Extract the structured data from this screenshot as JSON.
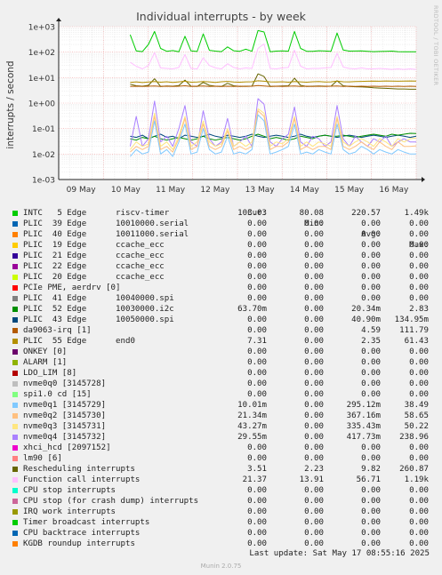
{
  "page": {
    "title": "Individual interrupts - by week",
    "watermark": "RRDTOOL / TOBI OETIKER",
    "last_update": "Last update: Sat May 17 08:55:16 2025",
    "footer": "Munin 2.0.75"
  },
  "legend_headers": {
    "cur": "Cur:",
    "min": "Min:",
    "avg": "Avg:",
    "max": "Max:"
  },
  "legend": [
    {
      "label": "INTC   5 Edge      riscv-timer",
      "color": "#00cc00",
      "cur": "103.03",
      "min": "80.08",
      "avg": "220.57",
      "max": "1.49k"
    },
    {
      "label": "PLIC  39 Edge      10010000.serial",
      "color": "#0066b3",
      "cur": "0.00",
      "min": "0.00",
      "avg": "0.00",
      "max": "0.00"
    },
    {
      "label": "PLIC  40 Edge      10011000.serial",
      "color": "#ff8000",
      "cur": "0.00",
      "min": "0.00",
      "avg": "0.00",
      "max": "0.00"
    },
    {
      "label": "PLIC  19 Edge      ccache_ecc",
      "color": "#ffcc00",
      "cur": "0.00",
      "min": "0.00",
      "avg": "0.00",
      "max": "0.00"
    },
    {
      "label": "PLIC  21 Edge      ccache_ecc",
      "color": "#330099",
      "cur": "0.00",
      "min": "0.00",
      "avg": "0.00",
      "max": "0.00"
    },
    {
      "label": "PLIC  22 Edge      ccache_ecc",
      "color": "#990099",
      "cur": "0.00",
      "min": "0.00",
      "avg": "0.00",
      "max": "0.00"
    },
    {
      "label": "PLIC  20 Edge      ccache_ecc",
      "color": "#ccff00",
      "cur": "0.00",
      "min": "0.00",
      "avg": "0.00",
      "max": "0.00"
    },
    {
      "label": "PCIe PME, aerdrv [0]",
      "color": "#ff0000",
      "cur": "0.00",
      "min": "0.00",
      "avg": "0.00",
      "max": "0.00"
    },
    {
      "label": "PLIC  41 Edge      10040000.spi",
      "color": "#808080",
      "cur": "0.00",
      "min": "0.00",
      "avg": "0.00",
      "max": "0.00"
    },
    {
      "label": "PLIC  52 Edge      10030000.i2c",
      "color": "#008f00",
      "cur": "63.70m",
      "min": "0.00",
      "avg": "20.34m",
      "max": "2.83"
    },
    {
      "label": "PLIC  43 Edge      10050000.spi",
      "color": "#00487d",
      "cur": "0.00",
      "min": "0.00",
      "avg": "40.90m",
      "max": "134.95m"
    },
    {
      "label": "da9063-irq [1]",
      "color": "#b35a00",
      "cur": "0.00",
      "min": "0.00",
      "avg": "4.59",
      "max": "111.79"
    },
    {
      "label": "PLIC  55 Edge      end0",
      "color": "#b38f00",
      "cur": "7.31",
      "min": "0.00",
      "avg": "2.35",
      "max": "61.43"
    },
    {
      "label": "ONKEY [0]",
      "color": "#6b006b",
      "cur": "0.00",
      "min": "0.00",
      "avg": "0.00",
      "max": "0.00"
    },
    {
      "label": "ALARM [1]",
      "color": "#8fb300",
      "cur": "0.00",
      "min": "0.00",
      "avg": "0.00",
      "max": "0.00"
    },
    {
      "label": "LDO_LIM [8]",
      "color": "#b30000",
      "cur": "0.00",
      "min": "0.00",
      "avg": "0.00",
      "max": "0.00"
    },
    {
      "label": "nvme0q0 [3145728]",
      "color": "#bebebe",
      "cur": "0.00",
      "min": "0.00",
      "avg": "0.00",
      "max": "0.00"
    },
    {
      "label": "spi1.0 cd [15]",
      "color": "#80ff80",
      "cur": "0.00",
      "min": "0.00",
      "avg": "0.00",
      "max": "0.00"
    },
    {
      "label": "nvme0q1 [3145729]",
      "color": "#80c9ff",
      "cur": "10.01m",
      "min": "0.00",
      "avg": "295.12m",
      "max": "38.49"
    },
    {
      "label": "nvme0q2 [3145730]",
      "color": "#ffc080",
      "cur": "21.34m",
      "min": "0.00",
      "avg": "367.16m",
      "max": "58.65"
    },
    {
      "label": "nvme0q3 [3145731]",
      "color": "#ffe680",
      "cur": "43.27m",
      "min": "0.00",
      "avg": "335.43m",
      "max": "50.22"
    },
    {
      "label": "nvme0q4 [3145732]",
      "color": "#aa80ff",
      "cur": "29.55m",
      "min": "0.00",
      "avg": "417.73m",
      "max": "238.96"
    },
    {
      "label": "xhci_hcd [2097152]",
      "color": "#ee00cc",
      "cur": "0.00",
      "min": "0.00",
      "avg": "0.00",
      "max": "0.00"
    },
    {
      "label": "lm90 [6]",
      "color": "#ff8080",
      "cur": "0.00",
      "min": "0.00",
      "avg": "0.00",
      "max": "0.00"
    },
    {
      "label": "Rescheduling interrupts",
      "color": "#666600",
      "cur": "3.51",
      "min": "2.23",
      "avg": "9.82",
      "max": "260.87"
    },
    {
      "label": "Function call interrupts",
      "color": "#ffbfff",
      "cur": "21.37",
      "min": "13.91",
      "avg": "56.71",
      "max": "1.19k"
    },
    {
      "label": "CPU stop interrupts",
      "color": "#00ffcc",
      "cur": "0.00",
      "min": "0.00",
      "avg": "0.00",
      "max": "0.00"
    },
    {
      "label": "CPU stop (for crash dump) interrupts",
      "color": "#cc6699",
      "cur": "0.00",
      "min": "0.00",
      "avg": "0.00",
      "max": "0.00"
    },
    {
      "label": "IRQ work interrupts",
      "color": "#999900",
      "cur": "0.00",
      "min": "0.00",
      "avg": "0.00",
      "max": "0.00"
    },
    {
      "label": "Timer broadcast interrupts",
      "color": "#00cc00",
      "cur": "0.00",
      "min": "0.00",
      "avg": "0.00",
      "max": "0.00"
    },
    {
      "label": "CPU backtrace interrupts",
      "color": "#0066b3",
      "cur": "0.00",
      "min": "0.00",
      "avg": "0.00",
      "max": "0.00"
    },
    {
      "label": "KGDB roundup interrupts",
      "color": "#ff8000",
      "cur": "0.00",
      "min": "0.00",
      "avg": "0.00",
      "max": "0.00"
    }
  ],
  "chart_data": {
    "type": "line",
    "title": "Individual interrupts - by week",
    "ylabel": "interrupts / second",
    "yscale": "log",
    "ylim": [
      0.001,
      1000
    ],
    "y_ticks": [
      "1e-03",
      "1e-02",
      "1e-01",
      "1e+00",
      "1e+01",
      "1e+02",
      "1e+03"
    ],
    "x_ticks": [
      "09 May",
      "10 May",
      "11 May",
      "12 May",
      "13 May",
      "14 May",
      "15 May",
      "16 May"
    ],
    "grid": true,
    "data_start_day": 1.6,
    "series": [
      {
        "name": "INTC   5 Edge      riscv-timer",
        "color": "#00cc00",
        "values": [
          480,
          112,
          105,
          200,
          650,
          140,
          108,
          115,
          104,
          420,
          112,
          106,
          520,
          118,
          110,
          105,
          160,
          113,
          108,
          130,
          108,
          700,
          620,
          104,
          110,
          112,
          109,
          650,
          140,
          108,
          107,
          113,
          111,
          108,
          560,
          121,
          110,
          111,
          112,
          108,
          105,
          106,
          108,
          110,
          105,
          103,
          104,
          103
        ]
      },
      {
        "name": "Function call interrupts",
        "color": "#ffbfff",
        "values": [
          40,
          28,
          22,
          30,
          95,
          24,
          23,
          22,
          25,
          80,
          23,
          22,
          60,
          30,
          24,
          22,
          35,
          25,
          22,
          24,
          23,
          140,
          210,
          23,
          22,
          24,
          25,
          120,
          28,
          22,
          23,
          23,
          24,
          25,
          90,
          26,
          23,
          22,
          24,
          22,
          22,
          23,
          22,
          21,
          22,
          21,
          22,
          21
        ]
      },
      {
        "name": "Rescheduling interrupts",
        "color": "#666600",
        "values": [
          5.5,
          4.8,
          4.6,
          5.0,
          9.0,
          4.5,
          4.7,
          4.6,
          4.9,
          8.0,
          4.6,
          4.5,
          6.5,
          5.0,
          4.6,
          4.5,
          6.0,
          4.8,
          4.5,
          4.6,
          4.6,
          14,
          11,
          4.5,
          4.6,
          4.7,
          4.8,
          9.5,
          5.0,
          4.5,
          4.6,
          4.7,
          4.6,
          4.6,
          7.5,
          4.8,
          4.5,
          4.4,
          4.3,
          4.2,
          4.0,
          3.9,
          3.8,
          3.7,
          3.6,
          3.6,
          3.5,
          3.5
        ]
      },
      {
        "name": "PLIC  55 Edge      end0",
        "color": "#b38f00",
        "values": [
          6.5,
          6.8,
          6.4,
          6.7,
          7.0,
          6.6,
          6.9,
          6.5,
          6.8,
          7.2,
          6.6,
          6.7,
          7.0,
          6.8,
          6.5,
          6.9,
          7.1,
          6.7,
          6.6,
          6.8,
          6.9,
          7.5,
          7.2,
          6.8,
          6.7,
          6.9,
          6.6,
          7.0,
          6.8,
          6.6,
          6.9,
          7.0,
          6.7,
          6.8,
          7.3,
          6.9,
          6.8,
          7.0,
          7.1,
          7.2,
          7.3,
          7.2,
          7.4,
          7.3,
          7.2,
          7.3,
          7.4,
          7.3
        ]
      },
      {
        "name": "PLIC  43 Edge      10050000.spi",
        "color": "#00487d",
        "values": [
          0.05,
          0.045,
          0.055,
          0.04,
          0.05,
          0.06,
          0.045,
          0.05,
          0.04,
          0.055,
          0.05,
          0.045,
          0.05,
          0.06,
          0.05,
          0.045,
          0.055,
          0.05,
          0.045,
          0.05,
          0.06,
          0.05,
          0.045,
          0.05,
          0.055,
          0.05,
          0.045,
          0.05,
          0.06,
          0.05,
          0.045,
          0.05,
          0.055,
          0.05,
          0.045,
          0.05,
          0.055,
          0.05,
          0.045,
          0.05,
          0.055,
          0.05,
          0.045,
          0.05,
          0.055,
          0.05,
          0.045,
          0.05
        ]
      },
      {
        "name": "PLIC  52 Edge      10030000.i2c",
        "color": "#008f00",
        "values": [
          0.04,
          0.035,
          0.045,
          0.04,
          0.05,
          0.04,
          0.035,
          0.04,
          0.045,
          0.04,
          0.035,
          0.04,
          0.05,
          0.04,
          0.035,
          0.04,
          0.045,
          0.04,
          0.035,
          0.04,
          0.05,
          0.06,
          0.05,
          0.04,
          0.045,
          0.04,
          0.035,
          0.04,
          0.05,
          0.045,
          0.04,
          0.05,
          0.055,
          0.05,
          0.05,
          0.055,
          0.05,
          0.045,
          0.05,
          0.055,
          0.06,
          0.055,
          0.05,
          0.06,
          0.055,
          0.06,
          0.065,
          0.064
        ]
      },
      {
        "name": "nvme0q4 [3145732]",
        "color": "#aa80ff",
        "values": [
          0.02,
          0.3,
          0.02,
          0.04,
          1.2,
          0.03,
          0.05,
          0.02,
          0.1,
          0.8,
          0.03,
          0.02,
          0.5,
          0.04,
          0.02,
          0.03,
          0.25,
          0.02,
          0.03,
          0.05,
          0.02,
          1.5,
          0.9,
          0.03,
          0.02,
          0.04,
          0.06,
          0.7,
          0.03,
          0.02,
          0.05,
          0.04,
          0.02,
          0.03,
          0.8,
          0.04,
          0.02,
          0.05,
          0.03,
          0.02,
          0.04,
          0.03,
          0.05,
          0.02,
          0.03,
          0.04,
          0.03,
          0.03
        ]
      },
      {
        "name": "nvme0q3 [3145731]",
        "color": "#ffe680",
        "values": [
          0.015,
          0.03,
          0.02,
          0.025,
          0.4,
          0.02,
          0.03,
          0.015,
          0.05,
          0.3,
          0.02,
          0.03,
          0.2,
          0.03,
          0.02,
          0.025,
          0.1,
          0.02,
          0.03,
          0.02,
          0.03,
          0.6,
          0.4,
          0.02,
          0.03,
          0.025,
          0.04,
          0.3,
          0.02,
          0.03,
          0.02,
          0.03,
          0.025,
          0.02,
          0.3,
          0.03,
          0.02,
          0.03,
          0.04,
          0.03,
          0.02,
          0.04,
          0.03,
          0.02,
          0.04,
          0.03,
          0.04,
          0.043
        ]
      },
      {
        "name": "nvme0q2 [3145730]",
        "color": "#ffc080",
        "values": [
          0.012,
          0.02,
          0.015,
          0.02,
          0.3,
          0.015,
          0.02,
          0.012,
          0.04,
          0.25,
          0.015,
          0.02,
          0.15,
          0.02,
          0.015,
          0.02,
          0.08,
          0.015,
          0.02,
          0.015,
          0.02,
          0.5,
          0.3,
          0.015,
          0.02,
          0.02,
          0.03,
          0.25,
          0.015,
          0.02,
          0.015,
          0.02,
          0.02,
          0.015,
          0.25,
          0.02,
          0.015,
          0.02,
          0.03,
          0.02,
          0.015,
          0.03,
          0.02,
          0.015,
          0.03,
          0.02,
          0.02,
          0.021
        ]
      },
      {
        "name": "nvme0q1 [3145729]",
        "color": "#80c9ff",
        "values": [
          0.008,
          0.015,
          0.01,
          0.012,
          0.2,
          0.01,
          0.015,
          0.008,
          0.03,
          0.15,
          0.01,
          0.012,
          0.1,
          0.015,
          0.01,
          0.012,
          0.05,
          0.01,
          0.012,
          0.01,
          0.015,
          0.35,
          0.2,
          0.01,
          0.012,
          0.015,
          0.02,
          0.15,
          0.01,
          0.012,
          0.01,
          0.015,
          0.012,
          0.01,
          0.15,
          0.015,
          0.01,
          0.012,
          0.02,
          0.015,
          0.01,
          0.015,
          0.012,
          0.01,
          0.015,
          0.012,
          0.01,
          0.01
        ]
      },
      {
        "name": "da9063-irq [1]",
        "color": "#b35a00",
        "values": [
          4.5,
          4.6,
          4.5,
          4.6,
          4.7,
          4.5,
          4.6,
          4.5,
          4.6,
          4.8,
          4.5,
          4.6,
          4.7,
          4.5,
          4.6,
          4.5,
          4.6,
          4.5,
          4.6,
          4.5,
          4.6,
          4.9,
          4.7,
          4.5,
          4.6,
          4.5,
          4.6,
          4.7,
          4.5,
          4.6,
          4.5,
          4.6,
          4.5,
          4.6,
          4.7,
          4.5,
          4.6,
          4.5,
          4.6,
          4.5,
          4.6,
          4.5,
          4.6,
          4.5,
          4.6,
          4.5,
          4.6,
          4.5
        ]
      }
    ]
  }
}
